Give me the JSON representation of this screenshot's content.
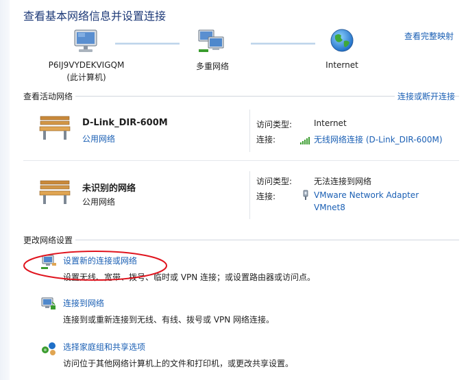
{
  "title": "查看基本网络信息并设置连接",
  "view_full_map": "查看完整映射",
  "map": {
    "computer_name": "P6IJ9VYDEKVIGQM",
    "computer_sub": "(此计算机)",
    "multi_network": "多重网络",
    "internet": "Internet"
  },
  "active_networks": {
    "section_label": "查看活动网络",
    "connect_disconnect": "连接或断开连接",
    "networks": [
      {
        "name": "D-Link_DIR-600M",
        "category": "公用网络",
        "access_type_label": "访问类型:",
        "access_type_value": "Internet",
        "connection_label": "连接:",
        "connection_value": "无线网络连接 (D-Link_DIR-600M)"
      },
      {
        "name": "未识别的网络",
        "category": "公用网络",
        "access_type_label": "访问类型:",
        "access_type_value": "无法连接到网络",
        "connection_label": "连接:",
        "connection_value_line1": "VMware Network Adapter",
        "connection_value_line2": "VMnet8"
      }
    ]
  },
  "change_settings": {
    "section_label": "更改网络设置",
    "tasks": [
      {
        "title": "设置新的连接或网络",
        "desc": "设置无线、宽带、拨号、临时或 VPN 连接；或设置路由器或访问点。"
      },
      {
        "title": "连接到网络",
        "desc": "连接到或重新连接到无线、有线、拨号或 VPN 网络连接。"
      },
      {
        "title": "选择家庭组和共享选项",
        "desc": "访问位于其他网络计算机上的文件和打印机，或更改共享设置。"
      }
    ]
  },
  "colors": {
    "link": "#1a5fb4",
    "title": "#1e3a78",
    "annotation": "#e0141e"
  }
}
